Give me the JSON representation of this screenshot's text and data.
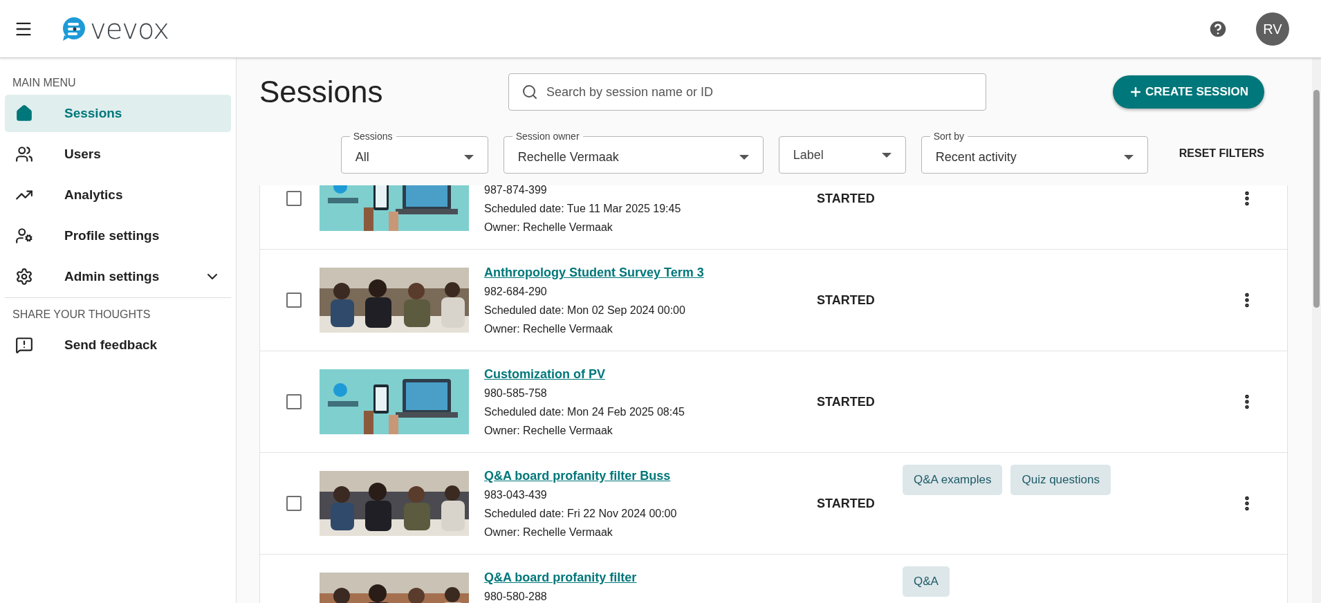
{
  "header": {
    "logo": "vevox",
    "avatar": "RV"
  },
  "sidebar": {
    "sections": [
      {
        "heading": "MAIN MENU",
        "items": [
          {
            "label": "Sessions",
            "kind": "link",
            "selected": true
          },
          {
            "label": "Users",
            "kind": "link",
            "selected": false
          },
          {
            "label": "Analytics",
            "kind": "link",
            "selected": false
          },
          {
            "label": "Profile settings",
            "kind": "link",
            "selected": false
          },
          {
            "label": "Admin settings",
            "kind": "group",
            "expanded": false,
            "selected": false
          }
        ]
      },
      {
        "heading": "SHARE YOUR THOUGHTS",
        "items": [
          {
            "label": "Send feedback",
            "kind": "link",
            "selected": false
          }
        ]
      }
    ]
  },
  "page": {
    "title": "Sessions",
    "search": {
      "placeholder": "Search by session name or ID"
    },
    "create_button": "CREATE SESSION"
  },
  "filters": [
    {
      "label": "Sessions",
      "value": "All"
    },
    {
      "label": "Session owner",
      "value": "Rechelle Vermaak"
    },
    {
      "placeholder": "Label"
    },
    {
      "label": "Sort by",
      "value": "Recent activity"
    }
  ],
  "reset_filters": "RESET FILTERS",
  "sessions": [
    {
      "checked": false,
      "id": "987-874-399",
      "scheduled": "Scheduled date: Tue 11 Mar 2025 19:45",
      "owner": "Owner: Rechelle Vermaak",
      "status": "STARTED"
    },
    {
      "checked": false,
      "title": "Anthropology Student Survey Term 3",
      "id": "982-684-290",
      "scheduled": "Scheduled date: Mon 02 Sep 2024 00:00",
      "owner": "Owner: Rechelle Vermaak",
      "status": "STARTED"
    },
    {
      "checked": false,
      "title": "Customization of PV",
      "id": "980-585-758",
      "scheduled": "Scheduled date: Mon 24 Feb 2025 08:45",
      "owner": "Owner: Rechelle Vermaak",
      "status": "STARTED"
    },
    {
      "checked": false,
      "title": "Q&A board profanity filter Buss",
      "id": "983-043-439",
      "scheduled": "Scheduled date: Fri 22 Nov 2024 00:00",
      "owner": "Owner: Rechelle Vermaak",
      "status": "STARTED",
      "tags": [
        "Q&A examples",
        "Quiz questions"
      ]
    },
    {
      "title": "Q&A board profanity filter",
      "id": "980-580-288",
      "tags": [
        "Q&A"
      ]
    }
  ]
}
